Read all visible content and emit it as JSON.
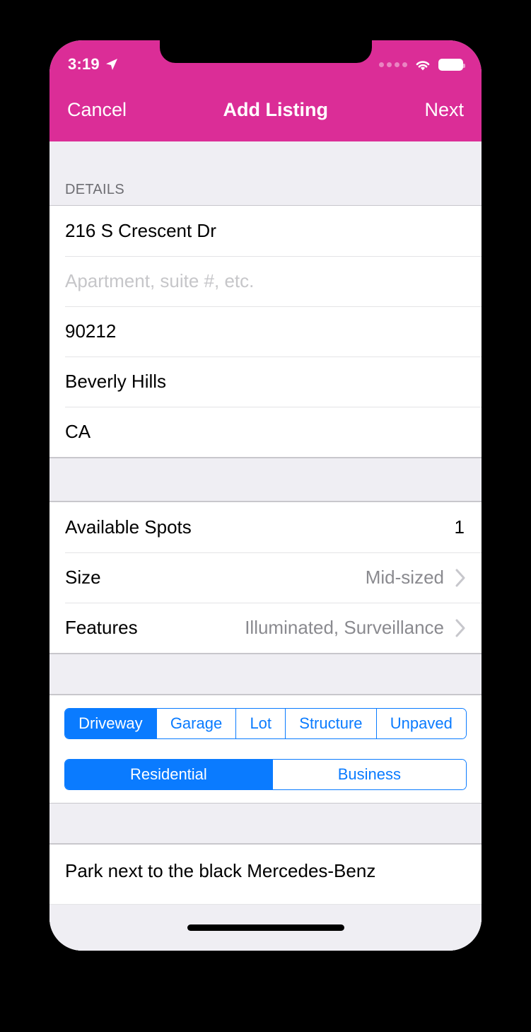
{
  "status_bar": {
    "time": "3:19",
    "location_icon": "location-arrow-icon",
    "cellular_icon": "cellular-dots-icon",
    "wifi_icon": "wifi-icon",
    "battery_icon": "battery-full-icon"
  },
  "nav": {
    "cancel_label": "Cancel",
    "title": "Add Listing",
    "next_label": "Next"
  },
  "colors": {
    "navbar_pink": "#DB2D97",
    "accent_blue": "#0A7BFF",
    "group_background": "#EFEEF3",
    "separator": "#C8C7CC",
    "secondary_text": "#8A8A8F",
    "placeholder_text": "#C6C6C9"
  },
  "details": {
    "header": "DETAILS",
    "fields": [
      {
        "value": "216 S Crescent Dr",
        "placeholder": "Street address",
        "is_placeholder": false
      },
      {
        "value": "Apartment, suite #, etc.",
        "placeholder": "Apartment, suite #, etc.",
        "is_placeholder": true
      },
      {
        "value": "90212",
        "placeholder": "ZIP",
        "is_placeholder": false
      },
      {
        "value": "Beverly Hills",
        "placeholder": "City",
        "is_placeholder": false
      },
      {
        "value": "CA",
        "placeholder": "State",
        "is_placeholder": false
      }
    ]
  },
  "spot_details": {
    "rows": [
      {
        "label": "Available Spots",
        "value": "1",
        "has_chevron": false
      },
      {
        "label": "Size",
        "value": "Mid-sized",
        "has_chevron": true
      },
      {
        "label": "Features",
        "value": "Illuminated, Surveillance",
        "has_chevron": true
      }
    ]
  },
  "segmented_controls": [
    {
      "name": "spot-type",
      "options": [
        "Driveway",
        "Garage",
        "Lot",
        "Structure",
        "Unpaved"
      ],
      "selected_index": 0
    },
    {
      "name": "property-type",
      "options": [
        "Residential",
        "Business"
      ],
      "selected_index": 0
    }
  ],
  "notes": {
    "value": "Park next to the black Mercedes-Benz",
    "placeholder": "Notes"
  },
  "home_indicator": "home-indicator"
}
